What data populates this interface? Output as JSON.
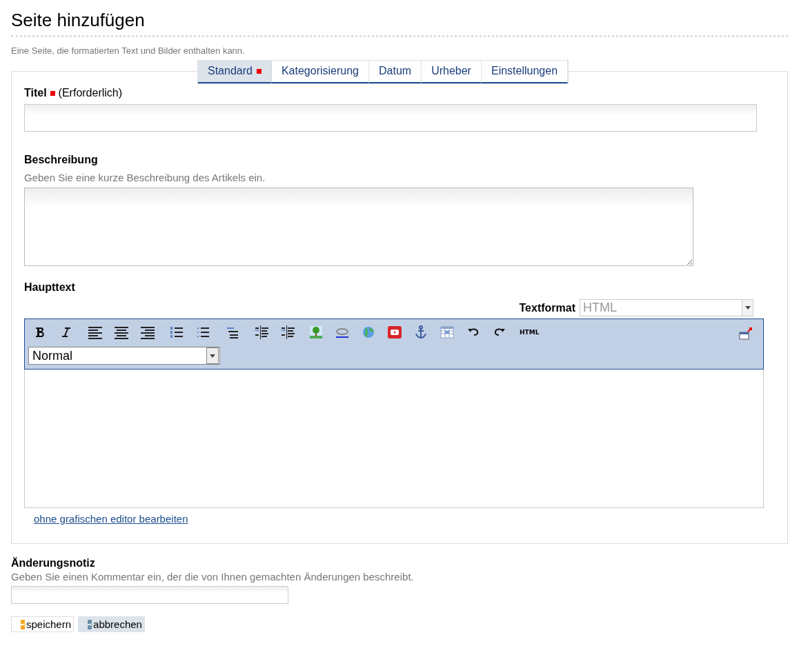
{
  "page": {
    "title": "Seite hinzufügen",
    "description": "Eine Seite, die formatierten Text und Bilder enthalten kann."
  },
  "tabs": [
    {
      "label": "Standard",
      "selected": true,
      "required": true
    },
    {
      "label": "Kategorisierung",
      "selected": false,
      "required": false
    },
    {
      "label": "Datum",
      "selected": false,
      "required": false
    },
    {
      "label": "Urheber",
      "selected": false,
      "required": false
    },
    {
      "label": "Einstellungen",
      "selected": false,
      "required": false
    }
  ],
  "title_field": {
    "label": "Titel",
    "required": true,
    "required_note": "(Erforderlich)"
  },
  "description_field": {
    "label": "Beschreibung",
    "help": "Geben Sie eine kurze Beschreibung des Artikels ein."
  },
  "body_field": {
    "label": "Haupttext",
    "format_label": "Textformat",
    "format_value": "HTML",
    "format_disabled": true,
    "toolbar": [
      [
        {
          "kind": "bold"
        },
        {
          "kind": "italic"
        }
      ],
      [
        {
          "kind": "align-left"
        },
        {
          "kind": "align-center"
        },
        {
          "kind": "align-right"
        }
      ],
      [
        {
          "kind": "ordered-list"
        },
        {
          "kind": "bullet-list"
        }
      ],
      [
        {
          "kind": "outdent"
        }
      ],
      [
        {
          "kind": "indent"
        },
        {
          "kind": "indent"
        }
      ],
      [
        {
          "kind": "image"
        },
        {
          "kind": "link"
        },
        {
          "kind": "globe"
        },
        {
          "kind": "video"
        },
        {
          "kind": "anchor"
        },
        {
          "kind": "table"
        },
        {
          "kind": "undo"
        },
        {
          "kind": "redo"
        },
        {
          "kind": "text",
          "label": "HTML"
        }
      ]
    ],
    "style_value": "Normal",
    "plain_link": "ohne grafischen editor bearbeiten"
  },
  "change_note": {
    "label": "Änderungsnotiz",
    "help": "Geben Sie einen Kommentar ein, der die von Ihnen gemachten Änderungen beschreibt."
  },
  "buttons": [
    {
      "label": "speichern",
      "kind": "primary"
    },
    {
      "label": "abbrechen",
      "kind": "secondary"
    }
  ]
}
